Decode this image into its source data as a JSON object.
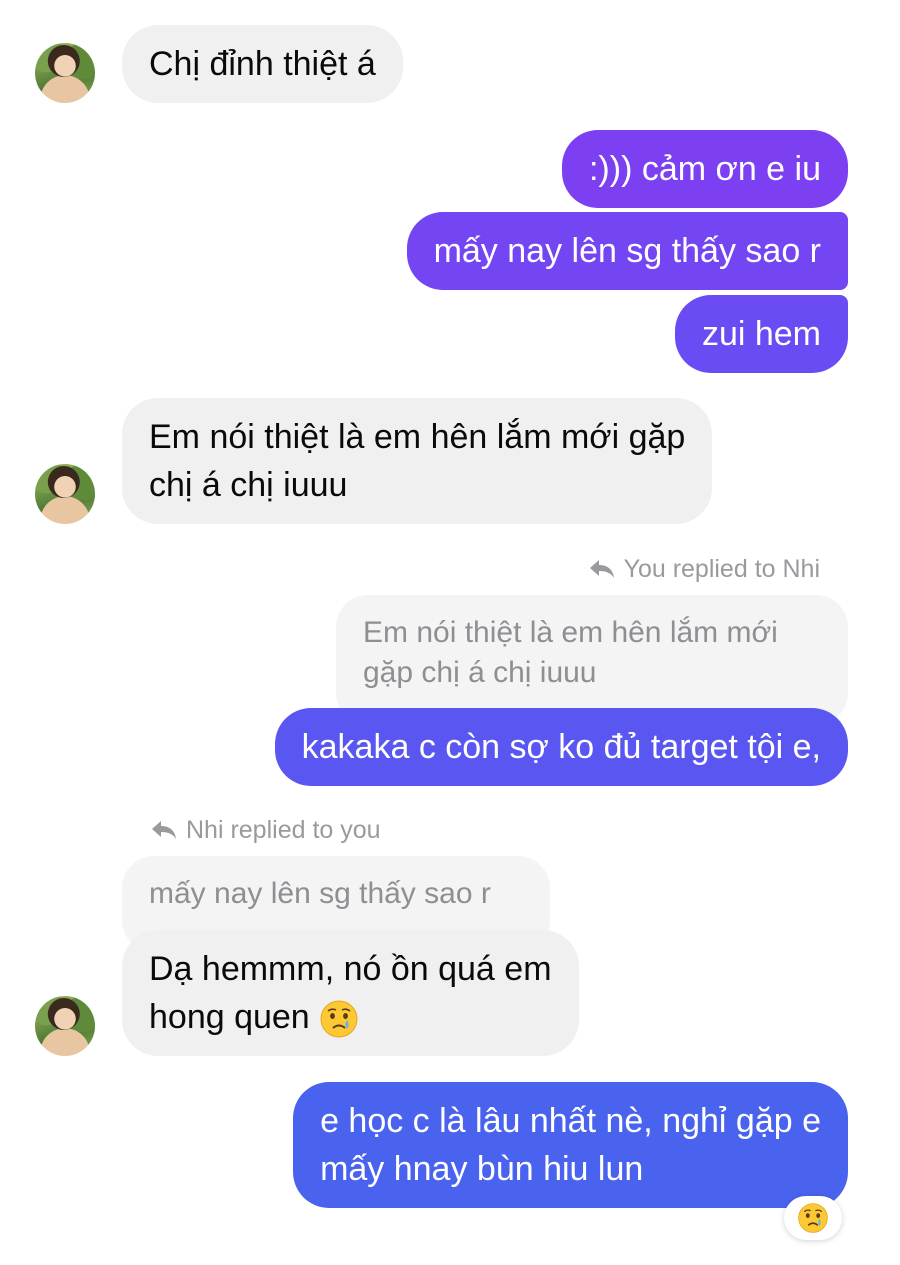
{
  "messages": {
    "m1": "Chị đỉnh thiệt á",
    "m2": ":))) cảm ơn e iu",
    "m3": "mấy nay lên sg thấy sao r",
    "m4": "zui hem",
    "m5_line1": "Em nói thiệt là em hên lắm mới gặp",
    "m5_line2": "chị á chị iuuu",
    "reply1_label": "You replied to Nhi",
    "reply1_quote_line1": "Em nói thiệt là em hên lắm mới",
    "reply1_quote_line2": "gặp chị á chị iuuu",
    "m6": "kakaka c còn sợ ko đủ target tội e,",
    "reply2_label": "Nhi replied to you",
    "reply2_quote": "mấy nay lên sg thấy sao r",
    "m7_line1": "Dạ hemmm, nó ồn quá em",
    "m7_line2": "hong quen",
    "m8_line1": "e học c là lâu nhất nè, nghỉ gặp e",
    "m8_line2": "mấy hnay bùn hiu lun"
  },
  "icons": {
    "crying_face": "crying-face-emoji",
    "reply_arrow": "reply-arrow-icon"
  },
  "colors": {
    "incoming_bubble": "#f0f0f0",
    "outgoing_purple": "#7b3ff2",
    "outgoing_violet": "#6a4cf5",
    "outgoing_blue": "#4a63ef",
    "meta_text": "#9a9a9e"
  }
}
